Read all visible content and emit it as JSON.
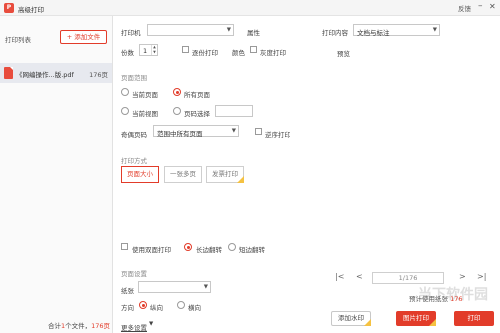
{
  "window": {
    "title": "高级打印",
    "feedback": "反馈",
    "icon": "pdf-app-icon",
    "logo_text": "P"
  },
  "file_list": {
    "label": "打印列表",
    "add_button": "+ 添加文件",
    "files": [
      {
        "name": "《网编操作...版.pdf",
        "pages": "176页"
      }
    ],
    "summary_prefix": "合计",
    "summary_count": "1",
    "summary_mid": "个文件，",
    "summary_pages": "176页"
  },
  "printer": {
    "label": "打印机",
    "value": "",
    "properties": "属性"
  },
  "print_content": {
    "label": "打印内容",
    "value": "文档与标注"
  },
  "copies": {
    "label": "份数",
    "value": "1",
    "collate": "逐份打印"
  },
  "color": {
    "label": "颜色",
    "grayscale": "灰度打印"
  },
  "preview": {
    "label": "预览"
  },
  "page_range": {
    "title": "页面范围",
    "current_page": "当前页面",
    "all_pages": "所有页面",
    "current_view": "当前视图",
    "page_select": "页码选择",
    "page_select_value": ""
  },
  "odd_even": {
    "label": "奇偶页码",
    "value": "范围中所有页面",
    "reverse": "逆序打印"
  },
  "print_mode": {
    "title": "打印方式",
    "modes": [
      "页面大小",
      "一张多页",
      "发票打印"
    ],
    "active_index": 0
  },
  "duplex": {
    "label": "使用双面打印",
    "long_edge": "长边翻转",
    "short_edge": "短边翻转"
  },
  "page_setup": {
    "title": "页面设置",
    "paper_label": "纸张",
    "paper_value": "",
    "orientation_label": "方向",
    "portrait": "纵向",
    "landscape": "横向",
    "more": "更多设置"
  },
  "pager": {
    "first": "|<",
    "prev": "<",
    "next": ">",
    "last": ">|",
    "page_display": "1/176"
  },
  "paper_usage": {
    "label": "预计使用纸张 ",
    "value": "176"
  },
  "buttons": {
    "watermark": "添加水印",
    "print_as_image": "图片打印",
    "print": "打印"
  },
  "watermark_text": "当下软件园",
  "colors": {
    "accent": "#e23c2a",
    "vip": "#f5c242"
  }
}
